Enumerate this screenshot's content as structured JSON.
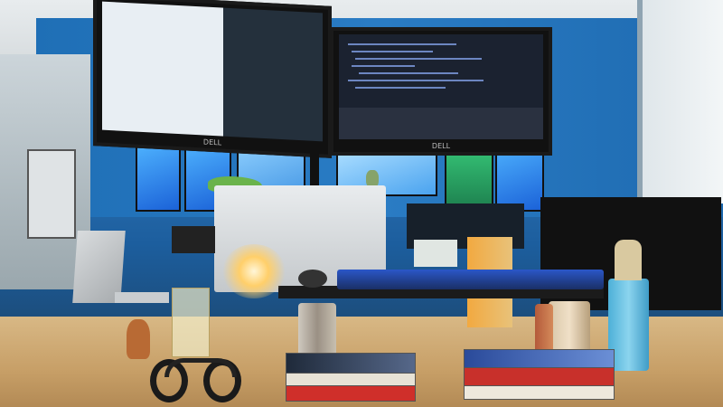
{
  "scene": {
    "description_labels": {
      "monitor_brand": "DELL"
    }
  }
}
